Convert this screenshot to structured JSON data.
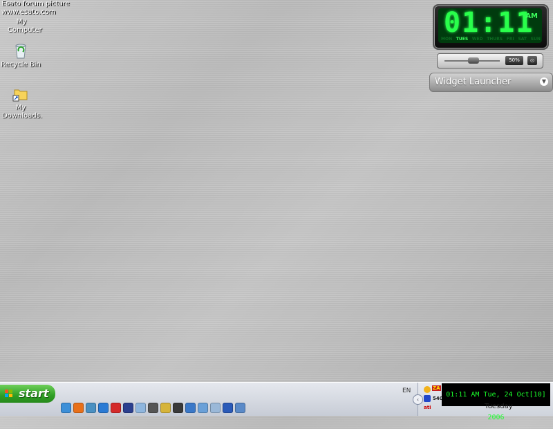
{
  "watermark": {
    "line1": "Esato forum picture",
    "line2": "www.esato.com"
  },
  "desktop_icons": [
    {
      "label": "My Computer",
      "icon": "computer-icon"
    },
    {
      "label": "Recycle Bin",
      "icon": "recycle-bin-icon"
    },
    {
      "label": "My Downloads.",
      "icon": "folder-shortcut-icon"
    }
  ],
  "clock_widget": {
    "time": "01:11",
    "ampm": "AM",
    "days": [
      "MON",
      "TUES",
      "WED",
      "THURS",
      "FRI",
      "SAT",
      "SUN"
    ],
    "active_day": "TUES",
    "color": "#29ff4b"
  },
  "volume_widget": {
    "percent_label": "50%",
    "level": 0.5
  },
  "widget_launcher": {
    "label": "Widget Launcher"
  },
  "taskbar": {
    "start_label": "start",
    "language": "EN",
    "quick_launch_icons": [
      "msn-icon",
      "firefox-icon",
      "network-icon",
      "internet-explorer-icon",
      "opera-icon",
      "media-player-icon",
      "itunes-icon",
      "sms-icon",
      "winamp-icon",
      "app-icon",
      "messenger-icon",
      "notepad-icon",
      "document-icon",
      "word-icon",
      "app2-icon"
    ],
    "tray": {
      "datetime": "01:11 AM  Tue, 24 Oct[10] 2006",
      "day": "Tuesday",
      "za_label": "ZA",
      "count_label": "540",
      "ati_label": "ati"
    }
  },
  "colors": {
    "start_green": "#2f9e25",
    "clock_green": "#1aff2b"
  }
}
